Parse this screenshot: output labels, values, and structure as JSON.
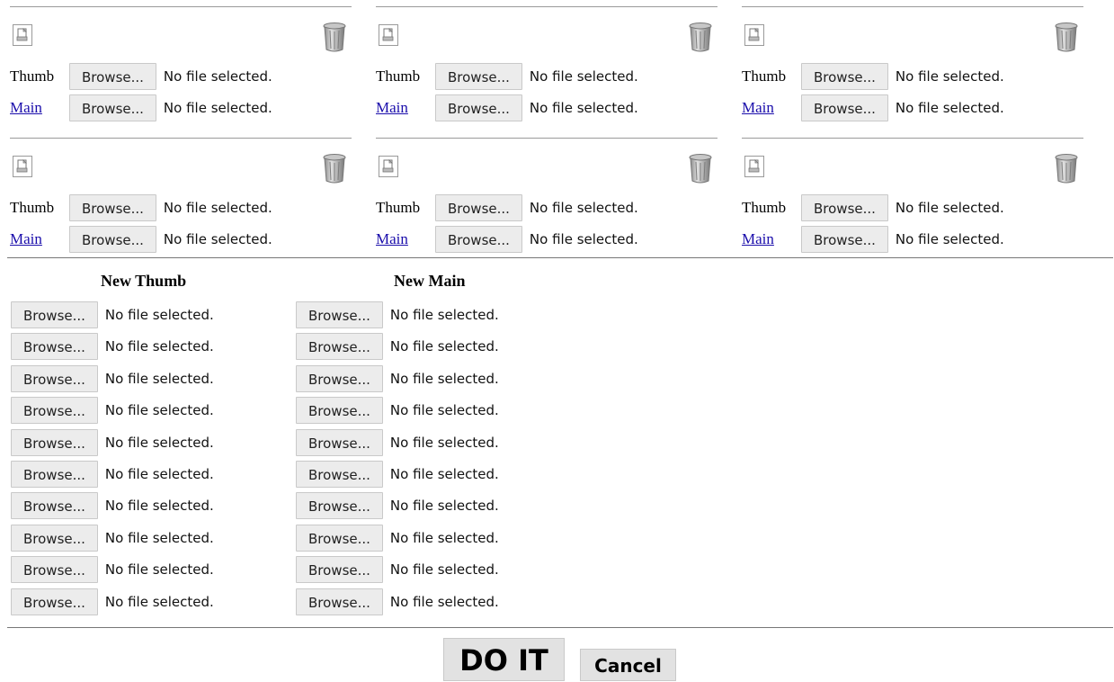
{
  "cards": [
    {
      "thumb_label": "Thumb",
      "main_label": "Main",
      "browse_label": "Browse...",
      "thumb_status": "No file selected.",
      "main_status": "No file selected."
    },
    {
      "thumb_label": "Thumb",
      "main_label": "Main",
      "browse_label": "Browse...",
      "thumb_status": "No file selected.",
      "main_status": "No file selected."
    },
    {
      "thumb_label": "Thumb",
      "main_label": "Main",
      "browse_label": "Browse...",
      "thumb_status": "No file selected.",
      "main_status": "No file selected."
    },
    {
      "thumb_label": "Thumb",
      "main_label": "Main",
      "browse_label": "Browse...",
      "thumb_status": "No file selected.",
      "main_status": "No file selected."
    },
    {
      "thumb_label": "Thumb",
      "main_label": "Main",
      "browse_label": "Browse...",
      "thumb_status": "No file selected.",
      "main_status": "No file selected."
    },
    {
      "thumb_label": "Thumb",
      "main_label": "Main",
      "browse_label": "Browse...",
      "thumb_status": "No file selected.",
      "main_status": "No file selected."
    }
  ],
  "new_uploads": {
    "thumb_header": "New Thumb",
    "main_header": "New Main",
    "browse_label": "Browse...",
    "status": "No file selected.",
    "row_count": 10
  },
  "actions": {
    "doit_label": "DO IT",
    "cancel_label": "Cancel"
  },
  "icons": {
    "image": "image-placeholder-icon",
    "delete": "trash-icon"
  },
  "colors": {
    "link": "#1a0dab",
    "button_bg": "#ececec"
  }
}
